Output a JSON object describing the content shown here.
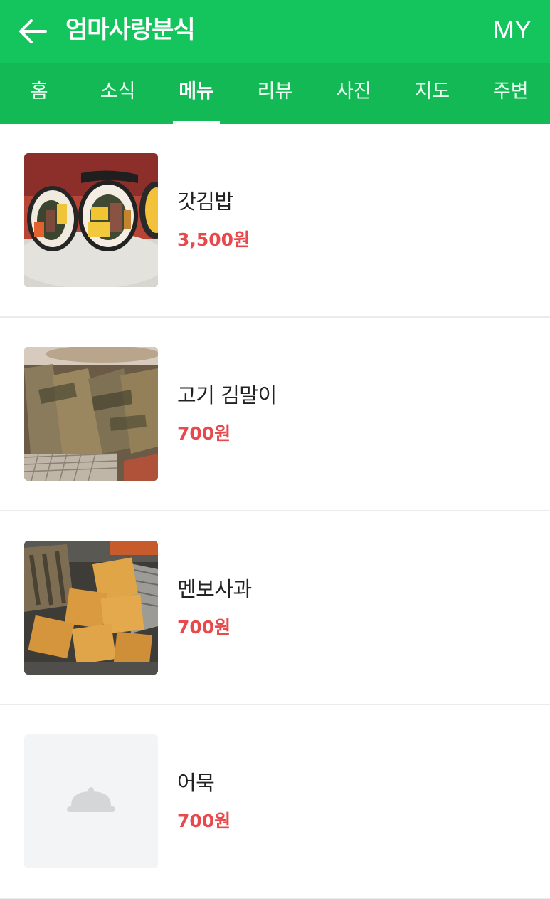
{
  "header": {
    "title": "엄마사랑분식",
    "my_label": "MY",
    "back_icon": "arrow-left-icon",
    "color": "#14c55d"
  },
  "tabs": [
    {
      "label": "홈",
      "active": false
    },
    {
      "label": "소식",
      "active": false
    },
    {
      "label": "메뉴",
      "active": true
    },
    {
      "label": "리뷰",
      "active": false
    },
    {
      "label": "사진",
      "active": false
    },
    {
      "label": "지도",
      "active": false
    },
    {
      "label": "주변",
      "active": false
    }
  ],
  "menu": {
    "items": [
      {
        "name": "갓김밥",
        "price": "3,500원",
        "image": "kimbap-photo"
      },
      {
        "name": "고기 김말이",
        "price": "700원",
        "image": "fried-seaweed-roll-photo"
      },
      {
        "name": "멘보사과",
        "price": "700원",
        "image": "fried-menbosha-photo"
      },
      {
        "name": "어묵",
        "price": "700원",
        "image": "food-cloche-placeholder-icon"
      }
    ],
    "price_color": "#e7494c"
  }
}
